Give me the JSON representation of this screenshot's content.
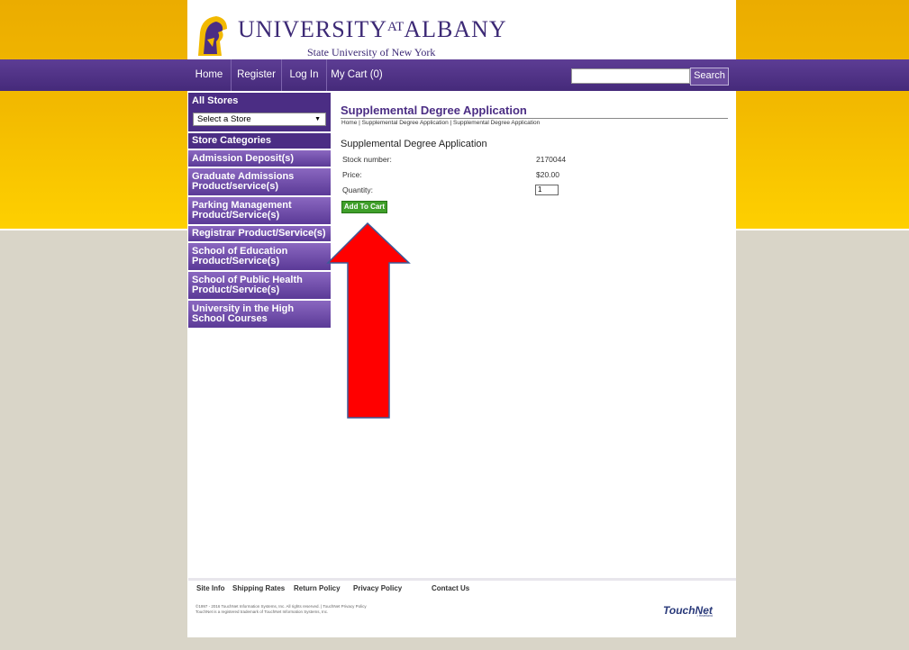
{
  "colors": {
    "purple": "#4b2d84",
    "gold": "#f2b900",
    "button_green": "#3f9f2a",
    "arrow_red": "#ff0000"
  },
  "header": {
    "logo_icon": "minerva-head-icon",
    "title_big": "UNIVERSITY",
    "title_small": "AT",
    "title_end": "ALBANY",
    "subtitle": "State University of New York"
  },
  "nav": {
    "home": "Home",
    "register": "Register",
    "login": "Log In",
    "cart": "My Cart (0)",
    "search_value": "",
    "search_button": "Search"
  },
  "sidebar": {
    "all_stores_heading": "All Stores",
    "store_select_value": "Select a Store",
    "categories_heading": "Store Categories",
    "items": [
      {
        "label": "Admission Deposit(s)"
      },
      {
        "label": "Graduate Admissions Product/service(s)"
      },
      {
        "label": "Parking Management Product/Service(s)"
      },
      {
        "label": "Registrar Product/Service(s)"
      },
      {
        "label": "School of Education Product/Service(s)"
      },
      {
        "label": "School of Public Health Product/Service(s)"
      },
      {
        "label": "University in the High School Courses"
      }
    ]
  },
  "main": {
    "page_title": "Supplemental Degree Application",
    "breadcrumb": "Home | Supplemental Degree Application | Supplemental Degree Application",
    "product_name": "Supplemental Degree Application",
    "stock_label": "Stock number:",
    "stock_value": "2170044",
    "price_label": "Price:",
    "price_value": "$20.00",
    "quantity_label": "Quantity:",
    "quantity_value": "1",
    "add_button": "Add To Cart"
  },
  "footer": {
    "links": [
      "Site Info",
      "Shipping Rates",
      "Return Policy",
      "Privacy Policy",
      "Contact Us"
    ],
    "copyright_line1": "©1997 - 2016 TouchNet Information Systems, Inc. All rights reserved. | TouchNet Privacy Policy",
    "copyright_line2": "TouchNet is a registered trademark of TouchNet Information Systems, Inc.",
    "touchnet_brand": "TouchNet",
    "touchnet_sub": "• Heartland"
  }
}
